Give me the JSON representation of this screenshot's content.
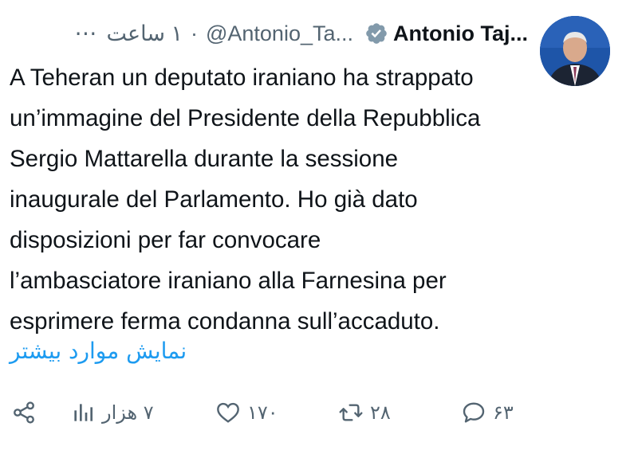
{
  "author": {
    "display_name": "Antonio Taj...",
    "handle": "@Antonio_Ta...",
    "time_ago": "۱ ساعت",
    "separator": "·",
    "more_icon": "⋯"
  },
  "tweet": {
    "lines": [
      "A Teheran un deputato iraniano ha strappato",
      "un’immagine del Presidente della Repubblica",
      "Sergio Mattarella durante la sessione",
      "inaugurale del Parlamento. Ho già dato",
      "disposizioni per far convocare",
      "l’ambasciatore iraniano alla Farnesina per",
      "esprimere ferma condanna sull’accaduto."
    ],
    "show_more": "نمایش موارد بیشتر"
  },
  "actions": {
    "views_count": "۷ هزار",
    "likes_count": "۱۷۰",
    "retweets_count": "۲۸",
    "replies_count": "۶۳"
  },
  "colors": {
    "accent": "#1d9bf0",
    "muted": "#536471",
    "text": "#0f1419"
  }
}
